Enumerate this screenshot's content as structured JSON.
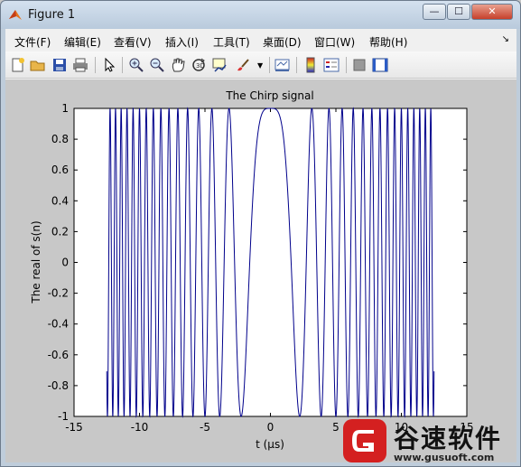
{
  "window": {
    "title": "Figure 1",
    "minimize_glyph": "—",
    "maximize_glyph": "☐",
    "close_glyph": "✕"
  },
  "menu": [
    "文件(F)",
    "编辑(E)",
    "查看(V)",
    "插入(I)",
    "工具(T)",
    "桌面(D)",
    "窗口(W)",
    "帮助(H)"
  ],
  "toolbar": {
    "icons": [
      "new-figure-icon",
      "open-file-icon",
      "save-icon",
      "print-icon",
      "pointer-icon",
      "zoom-in-icon",
      "zoom-out-icon",
      "pan-hand-icon",
      "rotate-3d-icon",
      "data-cursor-icon",
      "brush-icon",
      "link-plot-icon",
      "colorbar-icon",
      "legend-icon",
      "hide-plot-tools-icon",
      "show-plot-tools-icon"
    ]
  },
  "chart_data": {
    "type": "line",
    "title": "The Chirp signal",
    "xlabel": "t (μs)",
    "ylabel": "The real of s(n)",
    "xlim": [
      -15,
      15
    ],
    "ylim": [
      -1,
      1
    ],
    "x_ticks": [
      "-15",
      "-10",
      "-5",
      "0",
      "5",
      "10",
      "15"
    ],
    "y_ticks": [
      "1",
      "0.8",
      "0.6",
      "0.4",
      "0.2",
      "0",
      "-0.2",
      "-0.4",
      "-0.6",
      "-0.8",
      "-1"
    ],
    "grid": false,
    "series": [
      {
        "color": "#00008b",
        "function": "cos(pi*k*t^2)",
        "k": 0.2,
        "t_range": [
          -12.5,
          12.5
        ]
      }
    ]
  },
  "watermark": {
    "text": "谷速软件",
    "url": "www.gusuoft.com"
  }
}
